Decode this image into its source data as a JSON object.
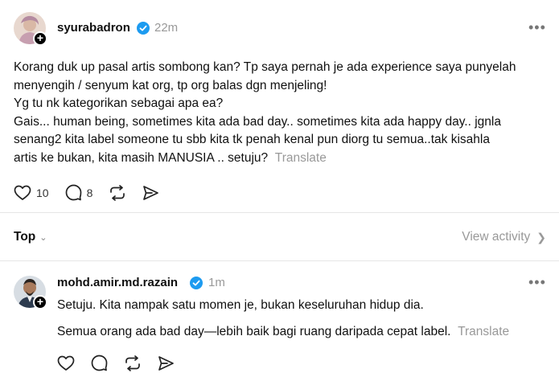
{
  "post": {
    "username": "syurabadron",
    "time": "22m",
    "lines": [
      "Korang duk up pasal artis sombong kan? Tp saya pernah je ada experience saya punyelah",
      "menyengih / senyum kat org, tp org balas dgn menjeling!",
      "Yg tu nk kategorikan sebagai apa ea?",
      "Gais... human being, sometimes kita ada bad day.. sometimes kita ada happy day.. jgnla",
      "senang2 kita label someone tu sbb kita tk penah kenal pun diorg tu semua..tak kisahla",
      "artis ke bukan, kita masih MANUSIA .. setuju?"
    ],
    "translate": "Translate",
    "likes": "10",
    "replies": "8"
  },
  "sort": {
    "label": "Top",
    "view_activity": "View activity"
  },
  "reply": {
    "username": "mohd.amir.md.razain",
    "time": "1m",
    "line1": "Setuju. Kita nampak satu momen je, bukan keseluruhan hidup dia.",
    "line2": "Semua orang ada bad day—lebih baik bagi ruang daripada cepat label.",
    "translate": "Translate"
  },
  "icons": {
    "like": "heart-icon",
    "reply": "speech-bubble-icon",
    "repost": "repost-icon",
    "share": "send-icon",
    "verified": "verified-badge-icon",
    "more": "more-dots-icon"
  },
  "colors": {
    "verified": "#1d9bf0",
    "muted": "#999999",
    "text": "#101010"
  }
}
